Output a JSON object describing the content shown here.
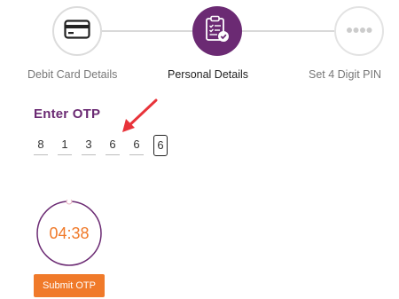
{
  "stepper": {
    "steps": [
      {
        "label": "Debit Card Details",
        "state": "done",
        "icon": "credit-card-icon"
      },
      {
        "label": "Personal Details",
        "state": "active",
        "icon": "clipboard-check-icon"
      },
      {
        "label": "Set 4 Digit PIN",
        "state": "pending",
        "icon": "pin-dots-icon"
      }
    ]
  },
  "otp": {
    "title": "Enter OTP",
    "digits": [
      "8",
      "1",
      "3",
      "6",
      "6",
      "6"
    ],
    "focused_index": 5
  },
  "timer": {
    "value": "04:38"
  },
  "submit": {
    "label": "Submit OTP"
  },
  "colors": {
    "brand_purple": "#6b2a73",
    "accent_orange": "#f07a2a",
    "annotation_red": "#e8333a"
  }
}
